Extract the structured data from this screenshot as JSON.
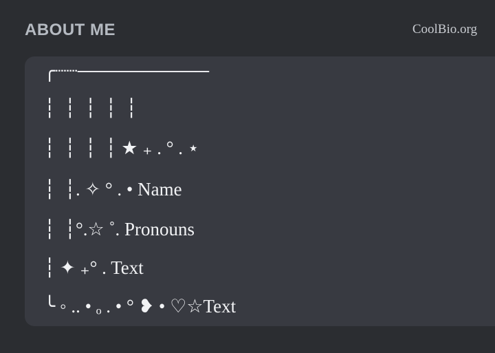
{
  "header": {
    "title": "ABOUT ME",
    "watermark": "CoolBio.org"
  },
  "bio": {
    "lines": [
      "╭┈┈──────────",
      "┆  ┆  ┆  ┆  ┆",
      "┆  ┆  ┆  ┆ ★ ₊ . ° . ⋆",
      "┆  ┆. ✧ ° . • Name",
      "┆  ┆°.☆ ˚. Pronouns",
      "┆ ✦ ₊° . Text",
      "╰ ◦ .. • ₒ . • ° ❥ • ♡☆Text"
    ]
  }
}
